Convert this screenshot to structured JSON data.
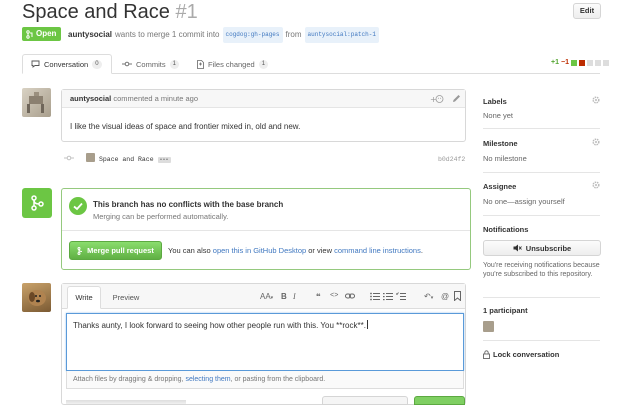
{
  "header": {
    "title": "Space and Race",
    "number": "#1",
    "edit_label": "Edit",
    "state": "Open",
    "author": "auntysocial",
    "merge_text": "wants to merge 1 commit into",
    "base_branch": "cogdog:gh-pages",
    "from_text": "from",
    "head_branch": "auntysocial:patch-1"
  },
  "tabs": [
    {
      "label": "Conversation",
      "count": "0"
    },
    {
      "label": "Commits",
      "count": "1"
    },
    {
      "label": "Files changed",
      "count": "1"
    }
  ],
  "diffstat": {
    "additions": "+1",
    "deletions": "−1"
  },
  "comment": {
    "author": "auntysocial",
    "time": "commented a minute ago",
    "body": "I like the visual ideas of space and frontier mixed in, old and new."
  },
  "commit": {
    "message": "Space and Race",
    "sha": "b0d24f2"
  },
  "merge": {
    "title": "This branch has no conflicts with the base branch",
    "subtitle": "Merging can be performed automatically.",
    "button": "Merge pull request",
    "alt_prefix": "You can also",
    "alt_link1": "open this in GitHub Desktop",
    "alt_mid": "or view",
    "alt_link2": "command line instructions",
    "alt_end": "."
  },
  "editor": {
    "write_tab": "Write",
    "preview_tab": "Preview",
    "text": "Thanks aunty, I look forward to seeing how other people run with this. You **rock**.",
    "attach_prefix": "Attach files by dragging & dropping,",
    "attach_link": "selecting them",
    "attach_suffix": ", or pasting from the clipboard."
  },
  "sidebar": {
    "labels_title": "Labels",
    "labels_value": "None yet",
    "milestone_title": "Milestone",
    "milestone_value": "No milestone",
    "assignee_title": "Assignee",
    "assignee_value": "No one—assign yourself",
    "notifications_title": "Notifications",
    "unsubscribe": "Unsubscribe",
    "notice": "You're receiving notifications because you're subscribed to this repository.",
    "participants": "1 participant",
    "lock": "Lock conversation"
  },
  "colors": {
    "open": "#6cc644",
    "link": "#4078c0",
    "add": "#55a532",
    "del": "#bd2c00"
  }
}
